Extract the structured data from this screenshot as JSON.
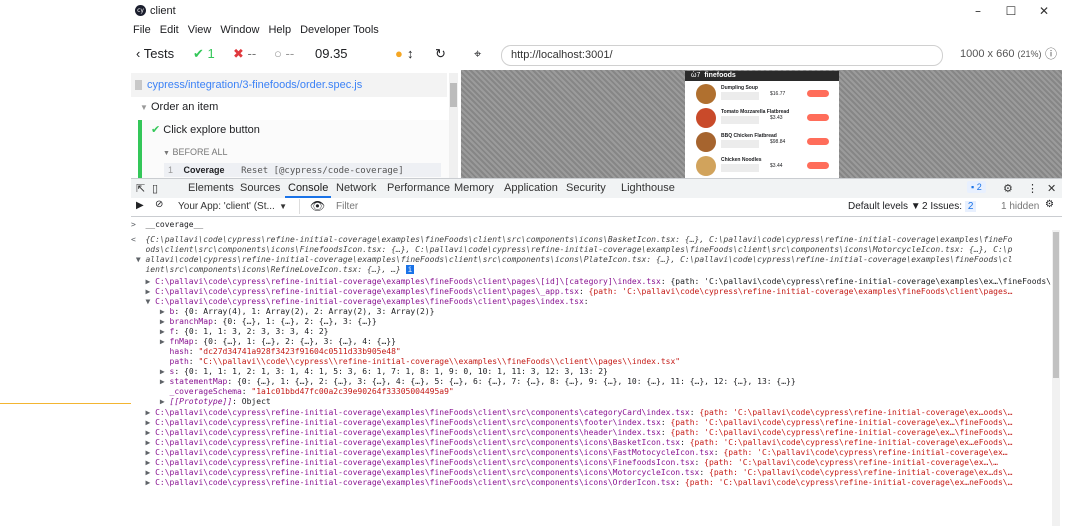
{
  "window": {
    "title": "client",
    "icon_text": "cy",
    "controls": [
      "–",
      "☐",
      "✕"
    ],
    "menu": [
      "File",
      "Edit",
      "View",
      "Window",
      "Help",
      "Developer Tools"
    ]
  },
  "cypress_toolbar": {
    "tests_label": "Tests",
    "passed": "1",
    "failed": "--",
    "pending": "--",
    "duration": "09.35",
    "url": "http://localhost:3001/",
    "viewport": "1000 x 660",
    "scale": "(21%)"
  },
  "reporter": {
    "spec_file": "cypress/integration/3-finefoods/order.spec.js",
    "suite": "Order an item",
    "test": "Click explore button",
    "hook": "BEFORE ALL",
    "command": {
      "index": "1",
      "name": "Coverage",
      "message": "Reset [@cypress/code-coverage]"
    }
  },
  "aut_app": {
    "brand": "finefoods",
    "cards": [
      {
        "name": "Dumpling Soup",
        "price": "$16.77"
      },
      {
        "name": "Tomato Mozzarella Flatbread",
        "price": "$3.43"
      },
      {
        "name": "BBQ Chicken Flatbread",
        "price": "$98.84"
      },
      {
        "name": "Chicken Noodles",
        "price": "$3.44"
      }
    ]
  },
  "devtools": {
    "tabs": [
      "Elements",
      "Sources",
      "Console",
      "Network",
      "Performance",
      "Memory",
      "Application",
      "Security",
      "Lighthouse"
    ],
    "active_tab": "Console",
    "issues_badge": "2",
    "context": "Your App: 'client' (St...",
    "filter_placeholder": "Filter",
    "default_levels": "Default levels ▼",
    "issues_label": "2 Issues:",
    "issues_count": "2",
    "hidden": "1 hidden"
  },
  "console": {
    "input": "__coverage__",
    "preview1": "{C:\\pallavi\\code\\cypress\\refine-initial-coverage\\examples\\fineFoods\\client\\src\\components\\icons\\BasketIcon.tsx: {…}, C:\\pallavi\\code\\cypress\\refine-initial-coverage\\examples\\fineFo",
    "preview2": "ods\\client\\src\\components\\icons\\FinefoodsIcon.tsx: {…}, C:\\pallavi\\code\\cypress\\refine-initial-coverage\\examples\\fineFoods\\client\\src\\components\\icons\\MotorcycleIcon.tsx: {…}, C:\\p",
    "preview3": "allavi\\code\\cypress\\refine-initial-coverage\\examples\\fineFoods\\client\\src\\components\\icons\\PlateIcon.tsx: {…}, C:\\pallavi\\code\\cypress\\refine-initial-coverage\\examples\\fineFoods\\cl",
    "preview4": "ient\\src\\components\\icons\\RefineLoveIcon.tsx: {…}, …}",
    "entry_category_key": "C:\\pallavi\\code\\cypress\\refine-initial-coverage\\examples\\fineFoods\\client\\pages\\[id]\\[category]\\index.tsx",
    "entry_category_val": "{path: 'C:\\pallavi\\code\\cypress\\refine-initial-coverage\\examples\\ex…\\fineFoods\\…",
    "entry_app_key": "C:\\pallavi\\code\\cypress\\refine-initial-coverage\\examples\\fineFoods\\client\\pages\\_app.tsx",
    "entry_app_val": "{path: 'C:\\pallavi\\code\\cypress\\refine-initial-coverage\\examples\\fineFoods\\client\\pages…",
    "entry_index_key": "C:\\pallavi\\code\\cypress\\refine-initial-coverage\\examples\\fineFoods\\client\\pages\\index.tsx",
    "entry_index_val": "",
    "props": [
      {
        "key": "b",
        "val": "{0: Array(4), 1: Array(2), 2: Array(2), 3: Array(2)}",
        "arrow": true
      },
      {
        "key": "branchMap",
        "val": "{0: {…}, 1: {…}, 2: {…}, 3: {…}}",
        "arrow": true
      },
      {
        "key": "f",
        "val": "{0: 1, 1: 3, 2: 3, 3: 3, 4: 2}",
        "arrow": true
      },
      {
        "key": "fnMap",
        "val": "{0: {…}, 1: {…}, 2: {…}, 3: {…}, 4: {…}}",
        "arrow": true
      },
      {
        "key": "hash",
        "val": "\"dc27d34741a928f3423f91604c0511d33b905e48\"",
        "arrow": false
      },
      {
        "key": "path",
        "val": "\"C:\\\\pallavi\\\\code\\\\cypress\\\\refine-initial-coverage\\\\examples\\\\fineFoods\\\\client\\\\pages\\\\index.tsx\"",
        "arrow": false
      },
      {
        "key": "s",
        "val": "{0: 1, 1: 1, 2: 1, 3: 1, 4: 1, 5: 3, 6: 1, 7: 1, 8: 1, 9: 0, 10: 1, 11: 3, 12: 3, 13: 2}",
        "arrow": true
      },
      {
        "key": "statementMap",
        "val": "{0: {…}, 1: {…}, 2: {…}, 3: {…}, 4: {…}, 5: {…}, 6: {…}, 7: {…}, 8: {…}, 9: {…}, 10: {…}, 11: {…}, 12: {…}, 13: {…}}",
        "arrow": true
      },
      {
        "key": "_coverageSchema",
        "val": "\"1a1c01bbd47fc00a2c39e90264f33305004495a9\"",
        "arrow": false
      },
      {
        "key": "[[Prototype]]",
        "val": "Object",
        "arrow": true
      }
    ],
    "tail": [
      {
        "key": "C:\\pallavi\\code\\cypress\\refine-initial-coverage\\examples\\fineFoods\\client\\src\\components\\categoryCard\\index.tsx",
        "val": "{path: 'C:\\pallavi\\code\\cypress\\refine-initial-coverage\\ex…oods\\…"
      },
      {
        "key": "C:\\pallavi\\code\\cypress\\refine-initial-coverage\\examples\\fineFoods\\client\\src\\components\\footer\\index.tsx",
        "val": "{path: 'C:\\pallavi\\code\\cypress\\refine-initial-coverage\\ex…\\fineFoods\\…"
      },
      {
        "key": "C:\\pallavi\\code\\cypress\\refine-initial-coverage\\examples\\fineFoods\\client\\src\\components\\header\\index.tsx",
        "val": "{path: 'C:\\pallavi\\code\\cypress\\refine-initial-coverage\\ex…\\fineFoods\\…"
      },
      {
        "key": "C:\\pallavi\\code\\cypress\\refine-initial-coverage\\examples\\fineFoods\\client\\src\\components\\icons\\BasketIcon.tsx",
        "val": "{path: 'C:\\pallavi\\code\\cypress\\refine-initial-coverage\\ex…eFoods\\…"
      },
      {
        "key": "C:\\pallavi\\code\\cypress\\refine-initial-coverage\\examples\\fineFoods\\client\\src\\components\\icons\\FastMotocycleIcon.tsx",
        "val": "{path: 'C:\\pallavi\\code\\cypress\\refine-initial-coverage\\ex…"
      },
      {
        "key": "C:\\pallavi\\code\\cypress\\refine-initial-coverage\\examples\\fineFoods\\client\\src\\components\\icons\\FinefoodsIcon.tsx",
        "val": "{path: 'C:\\pallavi\\code\\cypress\\refine-initial-coverage\\ex…\\…"
      },
      {
        "key": "C:\\pallavi\\code\\cypress\\refine-initial-coverage\\examples\\fineFoods\\client\\src\\components\\icons\\MotorcycleIcon.tsx",
        "val": "{path: 'C:\\pallavi\\code\\cypress\\refine-initial-coverage\\ex…ds\\…"
      },
      {
        "key": "C:\\pallavi\\code\\cypress\\refine-initial-coverage\\examples\\fineFoods\\client\\src\\components\\icons\\OrderIcon.tsx",
        "val": "{path: 'C:\\pallavi\\code\\cypress\\refine-initial-coverage\\ex…neFoods\\…"
      }
    ]
  },
  "colors": {
    "pass": "#34c759",
    "fail": "#e0393e",
    "accent": "#1a73e8",
    "console_key": "#881391",
    "console_string": "#c41a16",
    "console_number": "#1c00cf",
    "annotation": "#f3b531"
  }
}
